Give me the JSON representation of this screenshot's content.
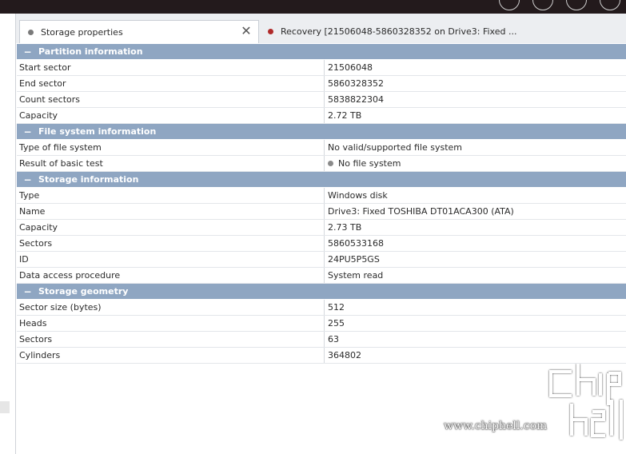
{
  "tabs": [
    {
      "label": "Storage properties",
      "dot_color": "#7a7a7a"
    },
    {
      "label": "Recovery [21506048-5860328352 on Drive3: Fixed ...",
      "dot_color": "#b02a2a"
    }
  ],
  "sections": [
    {
      "toggle": "−",
      "title": "Partition information",
      "rows": [
        {
          "key": "Start sector",
          "value": "21506048"
        },
        {
          "key": "End sector",
          "value": "5860328352"
        },
        {
          "key": "Count sectors",
          "value": "5838822304"
        },
        {
          "key": "Capacity",
          "value": "2.72 TB"
        }
      ]
    },
    {
      "toggle": "−",
      "title": "File system information",
      "rows": [
        {
          "key": "Type of file system",
          "value": "No valid/supported file system"
        },
        {
          "key": "Result of basic test",
          "value": "No file system"
        }
      ]
    },
    {
      "toggle": "−",
      "title": "Storage information",
      "rows": [
        {
          "key": "Type",
          "value": "Windows disk"
        },
        {
          "key": "Name",
          "value": "Drive3: Fixed TOSHIBA DT01ACA300 (ATA)"
        },
        {
          "key": "Capacity",
          "value": "2.73 TB"
        },
        {
          "key": "Sectors",
          "value": "5860533168"
        },
        {
          "key": "ID",
          "value": "24PU5P5GS"
        },
        {
          "key": "Data access procedure",
          "value": "System read"
        }
      ]
    },
    {
      "toggle": "−",
      "title": "Storage geometry",
      "rows": [
        {
          "key": "Sector size (bytes)",
          "value": "512"
        },
        {
          "key": "Heads",
          "value": "255"
        },
        {
          "key": "Sectors",
          "value": "63"
        },
        {
          "key": "Cylinders",
          "value": "364802"
        }
      ]
    }
  ],
  "watermark": {
    "site": "www.chiphell.com",
    "logo_text": "chip hell"
  },
  "colors": {
    "section_header": "#8fa6c2",
    "titlebar": "#231a1c"
  }
}
